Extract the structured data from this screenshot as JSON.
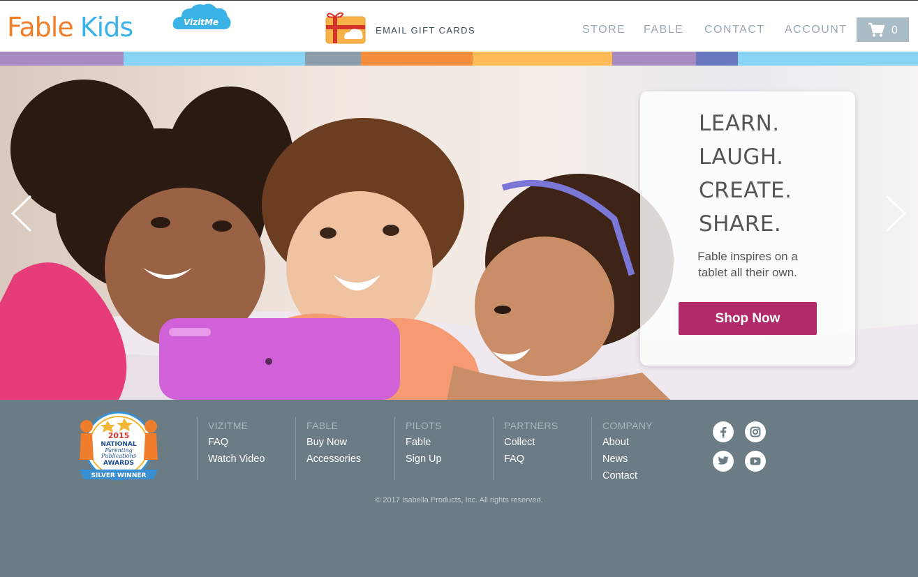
{
  "header": {
    "logo_fable": "Fable",
    "logo_kids": "Kids",
    "logo_badge": "VizitMe",
    "gift_label": "EMAIL GIFT CARDS",
    "nav": [
      "STORE",
      "FABLE",
      "CONTACT",
      "ACCOUNT"
    ],
    "cart_count": "0"
  },
  "stripe_colors": [
    "#a98bc4",
    "#88d4f5",
    "#8c9dab",
    "#f48d3c",
    "#ffbb55",
    "#a98bc4",
    "#6a78bf",
    "#88d4f5"
  ],
  "hero": {
    "tagline": [
      "LEARN.",
      "LAUGH.",
      "CREATE.",
      "SHARE."
    ],
    "description": "Fable inspires on a tablet all their own.",
    "cta": "Shop Now"
  },
  "footer": {
    "award": {
      "year": "2015",
      "line1": "NATIONAL",
      "line2": "Parenting",
      "line3": "Publications",
      "line4": "AWARDS",
      "ribbon": "SILVER WINNER"
    },
    "columns": [
      {
        "heading": "VIZITME",
        "links": [
          "FAQ",
          "Watch Video"
        ]
      },
      {
        "heading": "FABLE",
        "links": [
          "Buy Now",
          "Accessories"
        ]
      },
      {
        "heading": "PILOTS",
        "links": [
          "Fable",
          "Sign Up"
        ]
      },
      {
        "heading": "PARTNERS",
        "links": [
          "Collect",
          "FAQ"
        ]
      },
      {
        "heading": "COMPANY",
        "links": [
          "About",
          "News",
          "Contact"
        ]
      }
    ],
    "social": [
      "facebook-icon",
      "instagram-icon",
      "twitter-icon",
      "youtube-icon"
    ],
    "copyright": "© 2017 Isabella Products, Inc. All rights reserved."
  },
  "colors": {
    "brand_orange": "#f07f2c",
    "brand_blue": "#3cb3e6",
    "cta": "#b02a6a",
    "footer_bg": "#6b7c84"
  }
}
